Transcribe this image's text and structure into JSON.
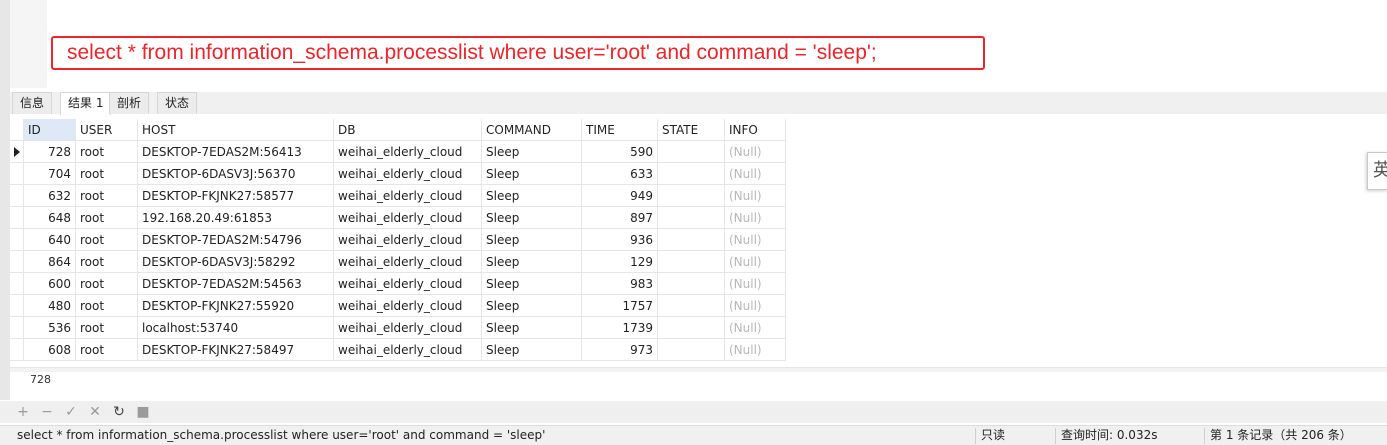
{
  "query_text": "select * from information_schema.processlist where user='root' and command = 'sleep';",
  "tabs": [
    {
      "label": "信息"
    },
    {
      "label": "结果 1"
    },
    {
      "label": "剖析"
    },
    {
      "label": "状态"
    }
  ],
  "columns": [
    "ID",
    "USER",
    "HOST",
    "DB",
    "COMMAND",
    "TIME",
    "STATE",
    "INFO"
  ],
  "rows": [
    {
      "id": "728",
      "user": "root",
      "host": "DESKTOP-7EDAS2M:56413",
      "db": "weihai_elderly_cloud",
      "command": "Sleep",
      "time": "590",
      "state": "",
      "info": "(Null)"
    },
    {
      "id": "704",
      "user": "root",
      "host": "DESKTOP-6DASV3J:56370",
      "db": "weihai_elderly_cloud",
      "command": "Sleep",
      "time": "633",
      "state": "",
      "info": "(Null)"
    },
    {
      "id": "632",
      "user": "root",
      "host": "DESKTOP-FKJNK27:58577",
      "db": "weihai_elderly_cloud",
      "command": "Sleep",
      "time": "949",
      "state": "",
      "info": "(Null)"
    },
    {
      "id": "648",
      "user": "root",
      "host": "192.168.20.49:61853",
      "db": "weihai_elderly_cloud",
      "command": "Sleep",
      "time": "897",
      "state": "",
      "info": "(Null)"
    },
    {
      "id": "640",
      "user": "root",
      "host": "DESKTOP-7EDAS2M:54796",
      "db": "weihai_elderly_cloud",
      "command": "Sleep",
      "time": "936",
      "state": "",
      "info": "(Null)"
    },
    {
      "id": "864",
      "user": "root",
      "host": "DESKTOP-6DASV3J:58292",
      "db": "weihai_elderly_cloud",
      "command": "Sleep",
      "time": "129",
      "state": "",
      "info": "(Null)"
    },
    {
      "id": "600",
      "user": "root",
      "host": "DESKTOP-7EDAS2M:54563",
      "db": "weihai_elderly_cloud",
      "command": "Sleep",
      "time": "983",
      "state": "",
      "info": "(Null)"
    },
    {
      "id": "480",
      "user": "root",
      "host": "DESKTOP-FKJNK27:55920",
      "db": "weihai_elderly_cloud",
      "command": "Sleep",
      "time": "1757",
      "state": "",
      "info": "(Null)"
    },
    {
      "id": "536",
      "user": "root",
      "host": "localhost:53740",
      "db": "weihai_elderly_cloud",
      "command": "Sleep",
      "time": "1739",
      "state": "",
      "info": "(Null)"
    },
    {
      "id": "608",
      "user": "root",
      "host": "DESKTOP-FKJNK27:58497",
      "db": "weihai_elderly_cloud",
      "command": "Sleep",
      "time": "973",
      "state": "",
      "info": "(Null)"
    }
  ],
  "detail_value": "728",
  "toolbar": {
    "add_icon": "plus-icon",
    "delete_icon": "minus-icon",
    "apply_icon": "check-icon",
    "discard_icon": "x-icon",
    "refresh_icon": "refresh-icon",
    "stop_icon": "stop-icon"
  },
  "status": {
    "sql": "select * from information_schema.processlist where user='root' and command = 'sleep'",
    "mode": "只读",
    "query_time": "查询时间: 0.032s",
    "record": "第 1 条记录（共 206 条）"
  },
  "ime_label": "英",
  "colors": {
    "query_red": "#e8262c",
    "header_selected": "#dde9f7",
    "null_text": "#b8b8b8"
  }
}
